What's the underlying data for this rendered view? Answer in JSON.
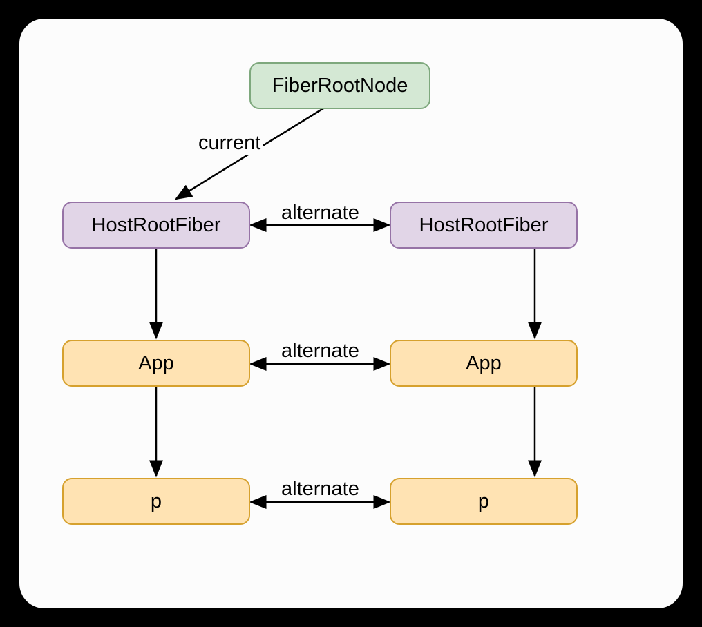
{
  "nodes": {
    "fiberRootNode": "FiberRootNode",
    "hostRootFiberLeft": "HostRootFiber",
    "hostRootFiberRight": "HostRootFiber",
    "appLeft": "App",
    "appRight": "App",
    "pLeft": "p",
    "pRight": "p"
  },
  "labels": {
    "current": "current",
    "alternate1": "alternate",
    "alternate2": "alternate",
    "alternate3": "alternate"
  },
  "colors": {
    "green_fill": "#d4e8d4",
    "green_stroke": "#7ea87d",
    "purple_fill": "#e1d5e7",
    "purple_stroke": "#9673a6",
    "orange_fill": "#ffe3b3",
    "orange_stroke": "#d6a12e"
  }
}
